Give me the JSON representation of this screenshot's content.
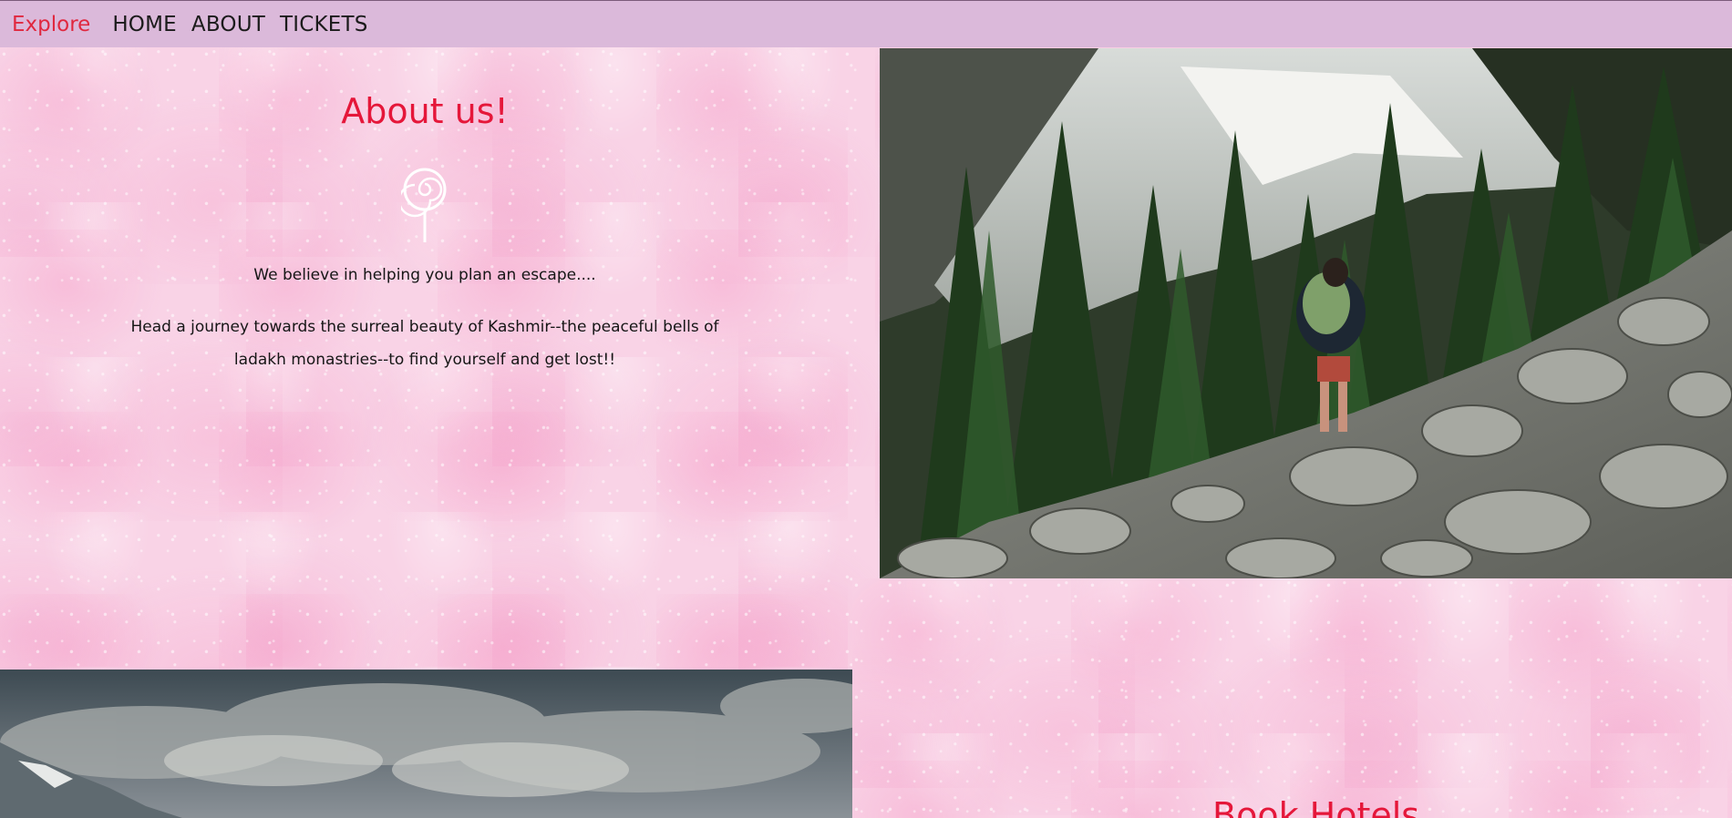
{
  "nav": {
    "brand": "Explore",
    "links": [
      "HOME",
      "ABOUT",
      "TICKETS"
    ]
  },
  "about": {
    "title": "About us!",
    "tagline": "We believe in helping you plan an escape....",
    "description": "Head a journey towards the surreal beauty of Kashmir--the peaceful bells of ladakh monastries--to find yourself and get lost!!"
  },
  "hotels": {
    "title": "Book Hotels"
  },
  "colors": {
    "accent": "#e5173a",
    "navbar": "#dbb9da",
    "background": "#f9d3e6"
  },
  "icons": {
    "about_icon": "lollipop-icon"
  }
}
